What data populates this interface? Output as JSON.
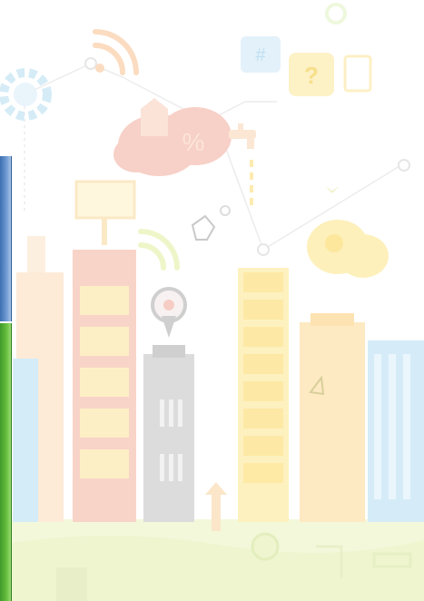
{
  "scene": {
    "description_labels": {
      "hashtag_symbol": "#",
      "question_symbol": "?",
      "percent_symbol": "%"
    },
    "colors": {
      "pale_yellow": "#fbf3c9",
      "pale_orange": "#fbe1c8",
      "pale_pink": "#f6c9bf",
      "pale_blue": "#cfe6f6",
      "pale_grey": "#d9d9d9",
      "ground": "#f2f7d9",
      "accent_blue": "#4a7cc0",
      "accent_green": "#5db53a"
    }
  },
  "side_panels": {
    "top_color": "blue",
    "bottom_color": "green"
  }
}
